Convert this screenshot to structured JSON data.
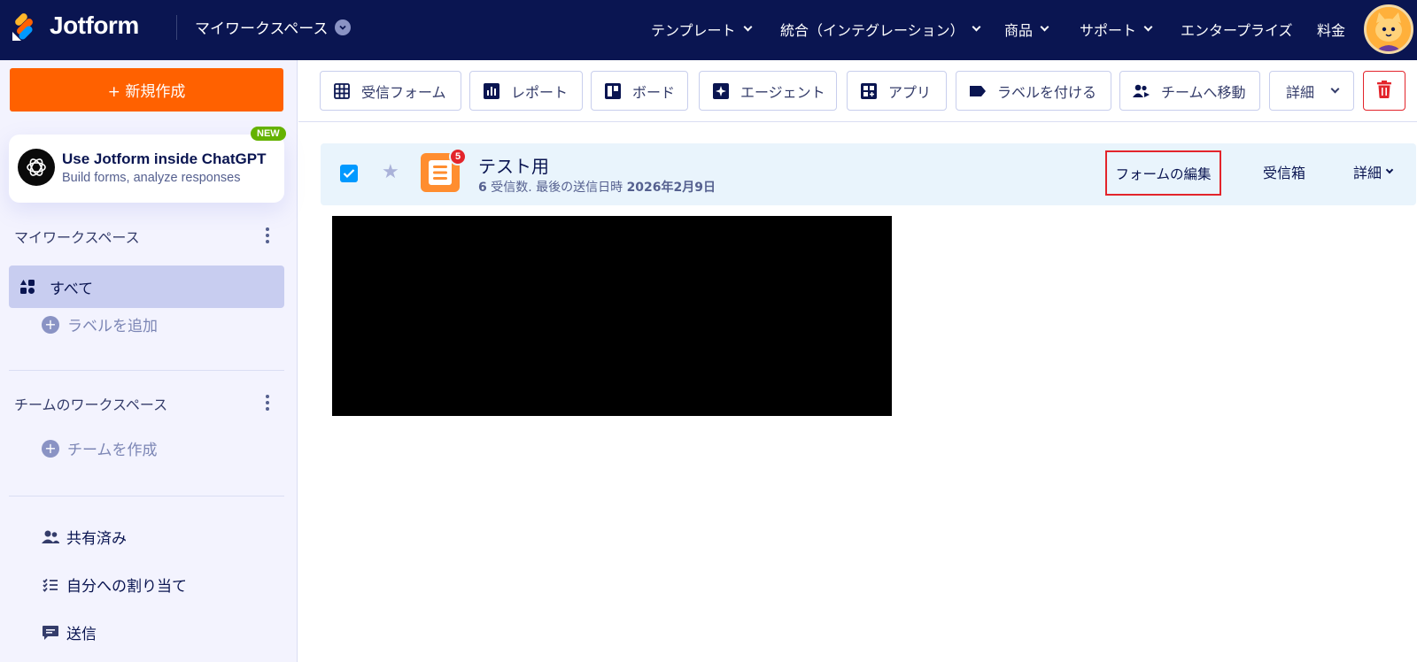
{
  "header": {
    "brand": "Jotform",
    "workspace_label": "マイワークスペース",
    "nav": [
      {
        "label": "テンプレート",
        "has_dropdown": true
      },
      {
        "label": "統合（インテグレーション）",
        "has_dropdown": true
      },
      {
        "label": "商品",
        "has_dropdown": true
      },
      {
        "label": "サポート",
        "has_dropdown": true
      },
      {
        "label": "エンタープライズ",
        "has_dropdown": false
      },
      {
        "label": "料金",
        "has_dropdown": false
      }
    ]
  },
  "sidebar": {
    "create_label": "+ 新規作成",
    "promo": {
      "title": "Use Jotform inside ChatGPT",
      "subtitle": "Build forms, analyze responses",
      "badge": "NEW"
    },
    "my_workspace": {
      "heading": "マイワークスペース",
      "all_label": "すべて",
      "add_label": "ラベルを追加"
    },
    "team_workspace": {
      "heading": "チームのワークスペース",
      "create_team": "チームを作成"
    },
    "bottom_items": [
      {
        "label": "共有済み",
        "icon": "users-icon"
      },
      {
        "label": "自分への割り当て",
        "icon": "checklist-icon"
      },
      {
        "label": "送信",
        "icon": "message-icon"
      }
    ]
  },
  "toolbar": {
    "buttons": [
      {
        "label": "受信フォーム",
        "icon": "table-icon"
      },
      {
        "label": "レポート",
        "icon": "report-icon"
      },
      {
        "label": "ボード",
        "icon": "board-icon"
      },
      {
        "label": "エージェント",
        "icon": "agent-icon"
      },
      {
        "label": "アプリ",
        "icon": "app-icon"
      },
      {
        "label": "ラベルを付ける",
        "icon": "tag-icon"
      },
      {
        "label": "チームへ移動",
        "icon": "team-move-icon"
      },
      {
        "label": "詳細",
        "icon": "chevron-down-icon"
      }
    ]
  },
  "form_row": {
    "selected": true,
    "title": "テスト用",
    "badge_count": "5",
    "submissions_count": "6",
    "submissions_label": "受信数. 最後の送信日時",
    "last_date": "2026年2月9日",
    "edit_label": "フォームの編集",
    "inbox_label": "受信箱",
    "more_label": "詳細"
  },
  "colors": {
    "nav_bg": "#0a1551",
    "create_orange": "#ff6100",
    "highlight_red": "#e3242b",
    "row_bg": "#e9f4fc"
  }
}
